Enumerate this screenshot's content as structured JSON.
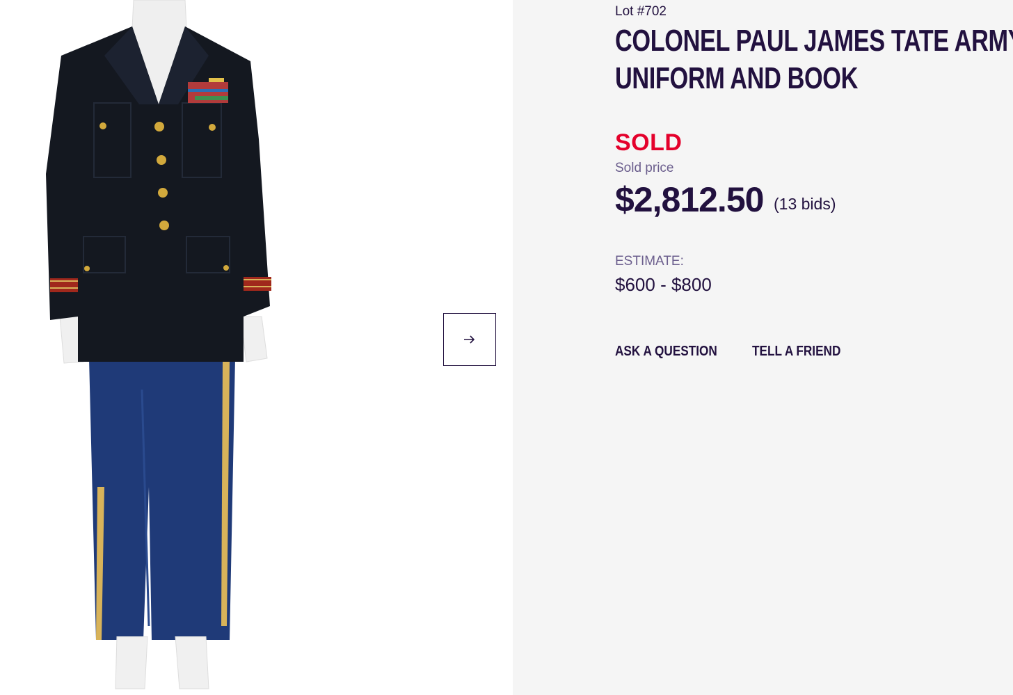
{
  "lot": {
    "number_label": "Lot #702"
  },
  "item": {
    "title_line1": "COLONEL PAUL JAMES TATE ARMY OFFICER",
    "title_line2": "UNIFORM AND BOOK"
  },
  "status": {
    "sold_label": "SOLD"
  },
  "pricing": {
    "sold_price_label": "Sold price",
    "sold_price": "$2,812.50",
    "bids": "(13 bids)",
    "estimate_label": "ESTIMATE:",
    "estimate": "$600 - $800"
  },
  "actions": {
    "ask_question": "ASK A QUESTION",
    "tell_friend": "TELL A FRIEND"
  },
  "gallery": {
    "next_icon": "arrow-right-icon",
    "image": "army-uniform-on-mannequin"
  },
  "colors": {
    "brand_dark": "#22113f",
    "sold_red": "#e4002b",
    "muted_purple": "#6b5e8d",
    "panel_bg": "#f5f5f5"
  }
}
